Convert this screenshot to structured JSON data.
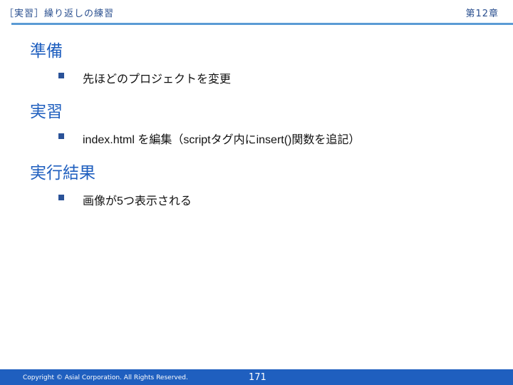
{
  "header": {
    "title": "［実習］繰り返しの練習",
    "chapter": "第12章"
  },
  "sections": [
    {
      "heading": "準備",
      "bullet": "先ほどのプロジェクトを変更"
    },
    {
      "heading": "実習",
      "bullet": "index.html を編集（scriptタグ内にinsert()関数を追記）"
    },
    {
      "heading": "実行結果",
      "bullet": "画像が5つ表示される"
    }
  ],
  "footer": {
    "copyright": "Copyright © Asial Corporation. All Rights Reserved.",
    "page_number": "171"
  },
  "colors": {
    "accent": "#1f5fbf",
    "rule": "#5b9bd5",
    "bullet": "#2a5298"
  }
}
